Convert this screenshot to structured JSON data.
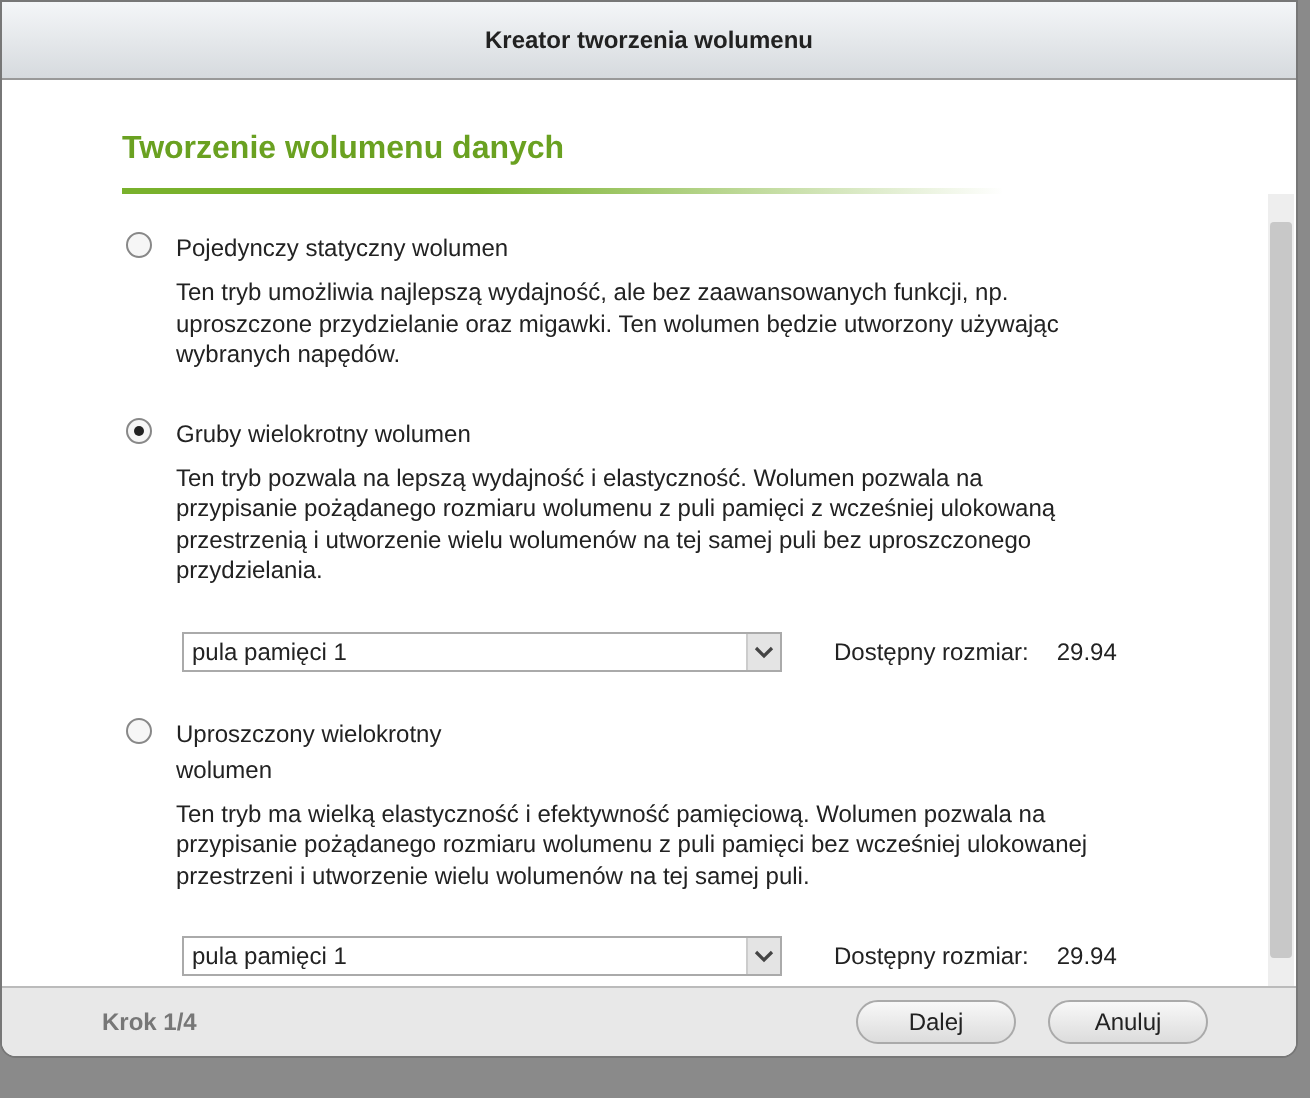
{
  "window": {
    "title": "Kreator tworzenia wolumenu"
  },
  "heading": "Tworzenie wolumenu danych",
  "options": [
    {
      "label": "Pojedynczy statyczny wolumen",
      "selected": false,
      "description": "Ten tryb umożliwia najlepszą wydajność, ale bez zaawansowanych funkcji, np. uproszczone przydzielanie oraz migawki. Ten wolumen będzie utworzony używając wybranych napędów."
    },
    {
      "label": "Gruby wielokrotny wolumen",
      "selected": true,
      "description": "Ten tryb pozwala na lepszą wydajność i elastyczność. Wolumen pozwala na przypisanie pożądanego rozmiaru wolumenu z puli pamięci z wcześniej ulokowaną przestrzenią i utworzenie wielu wolumenów na tej samej puli bez uproszczonego przydzielania.",
      "pool": {
        "value": "pula pamięci 1",
        "size_label": "Dostępny rozmiar:",
        "size": "29.94"
      }
    },
    {
      "label": "Uproszczony wielokrotny wolumen",
      "selected": false,
      "description": "Ten tryb ma wielką elastyczność i efektywność pamięciową. Wolumen pozwala na przypisanie pożądanego rozmiaru wolumenu z puli pamięci bez wcześniej ulokowanej przestrzeni i utworzenie wielu wolumenów na tej samej puli.",
      "pool": {
        "value": "pula pamięci 1",
        "size_label": "Dostępny rozmiar:",
        "size": "29.94"
      }
    }
  ],
  "footer": {
    "step": "Krok 1/4",
    "buttons": [
      "Dalej",
      "Anuluj"
    ]
  }
}
